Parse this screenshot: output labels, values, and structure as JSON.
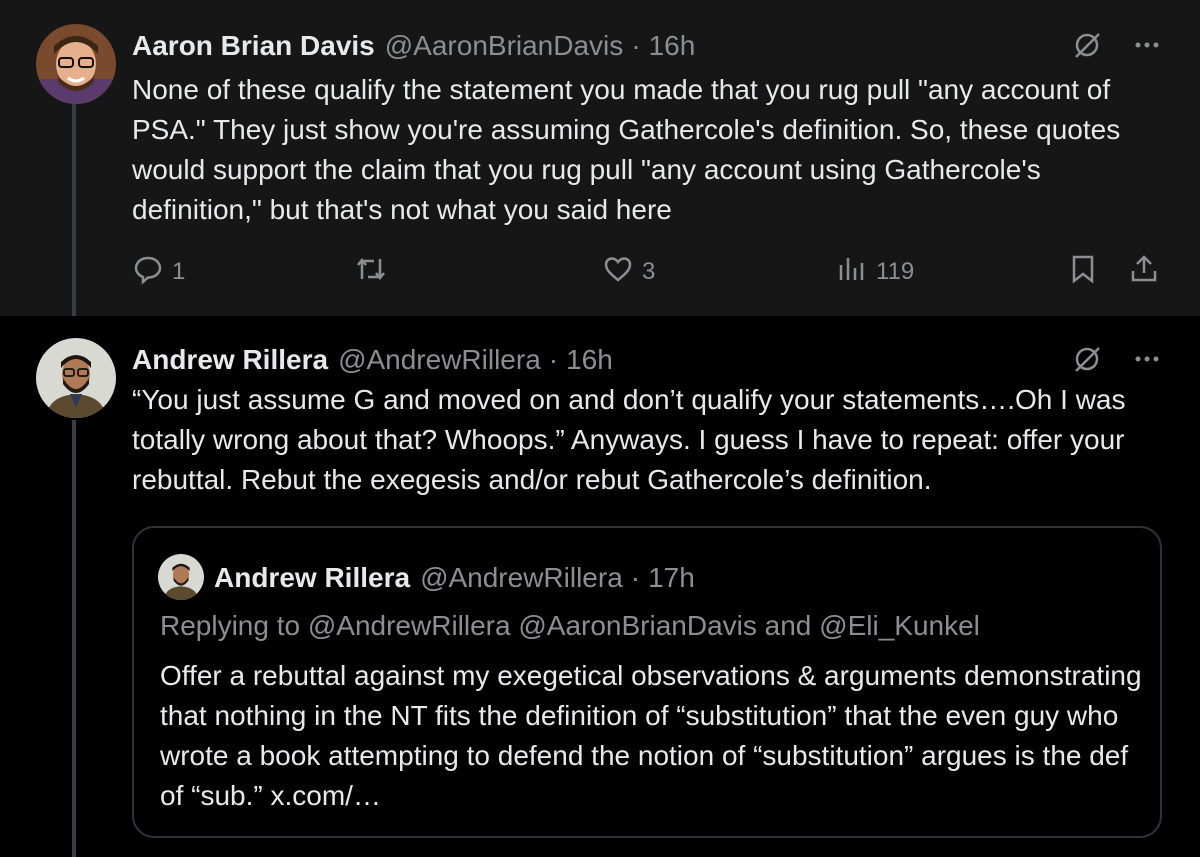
{
  "tweets": [
    {
      "name": "Aaron Brian Davis",
      "handle": "@AaronBrianDavis",
      "separator": "·",
      "time": "16h",
      "text": "None of these qualify the statement you made that you rug pull \"any account of PSA.\" They just show you're assuming Gathercole's definition. So, these quotes would support the claim that you rug pull \"any account using Gathercole's definition,\" but that's not what you said here",
      "stats": {
        "replies": "1",
        "reposts": "",
        "likes": "3",
        "views": "119"
      },
      "icons": [
        "grok-icon",
        "more-icon",
        "reply-icon",
        "repost-icon",
        "like-icon",
        "views-icon",
        "bookmark-icon",
        "share-icon"
      ]
    },
    {
      "name": "Andrew Rillera",
      "handle": "@AndrewRillera",
      "separator": "·",
      "time": "16h",
      "text": "“You just assume G and moved on and don’t qualify your statements….Oh I was totally wrong about that? Whoops.” Anyways. I guess I have to repeat: offer your rebuttal. Rebut the exegesis and/or rebut Gathercole’s definition.",
      "quote": {
        "name": "Andrew Rillera",
        "handle": "@AndrewRillera",
        "separator": "·",
        "time": "17h",
        "replying": "Replying to @AndrewRillera @AaronBrianDavis and @Eli_Kunkel",
        "text": "Offer a rebuttal against my exegetical observations & arguments demonstrating that nothing in the NT fits the definition of “substitution” that the even guy who wrote a book attempting to defend the notion of “substitution” argues is the def of “sub.” x.com/…"
      }
    }
  ],
  "colors": {
    "background": "#000000",
    "first_tweet_background": "#161616",
    "text": "#e7e9ea",
    "muted": "#8b8f94",
    "border": "#2f3336"
  }
}
